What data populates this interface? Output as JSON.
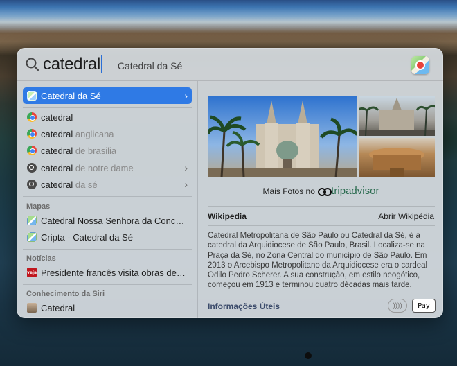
{
  "search": {
    "query": "catedral",
    "completion": "— Catedral da Sé"
  },
  "results": {
    "top_hit": "Catedral da Sé",
    "suggestions": [
      {
        "typed": "catedral",
        "rest": ""
      },
      {
        "typed": "catedral",
        "rest": " anglicana"
      },
      {
        "typed": "catedral",
        "rest": " de brasilia"
      },
      {
        "typed": "catedral",
        "rest": " de notre dame"
      },
      {
        "typed": "catedral",
        "rest": " da sé"
      }
    ],
    "maps_label": "Mapas",
    "maps_items": [
      "Catedral Nossa Senhora da Conceiçã...",
      "Cripta - Catedral da Sé"
    ],
    "news_label": "Notícias",
    "news_items": [
      "Presidente francês visita obras de Not..."
    ],
    "news_icon_text": "veja",
    "siri_label": "Conhecimento da Siri",
    "siri_items": [
      "Catedral"
    ]
  },
  "preview": {
    "more_photos": "Mais Fotos no",
    "tripadvisor": "tripadvisor",
    "wiki_title": "Wikipedia",
    "wiki_open": "Abrir Wikipédia",
    "wiki_text": "Catedral Metropolitana de São Paulo ou Catedral da Sé, é a catedral da Arquidiocese de São Paulo, Brasil. Localiza-se na Praça da Sé, no Zona Central do município de São Paulo. Em 2013 o Arcebispo Metropolitano da Arquidiocese era o cardeal Odilo Pedro Scherer. A sua construção, em estilo neogótico, começou em 1913 e terminou quatro décadas mais tarde.",
    "info_title": "Informações Úteis",
    "contactless": "))))",
    "applepay": " Pay"
  },
  "colors": {
    "selection": "#2f7ae5",
    "panel": "#d6dbe0"
  }
}
